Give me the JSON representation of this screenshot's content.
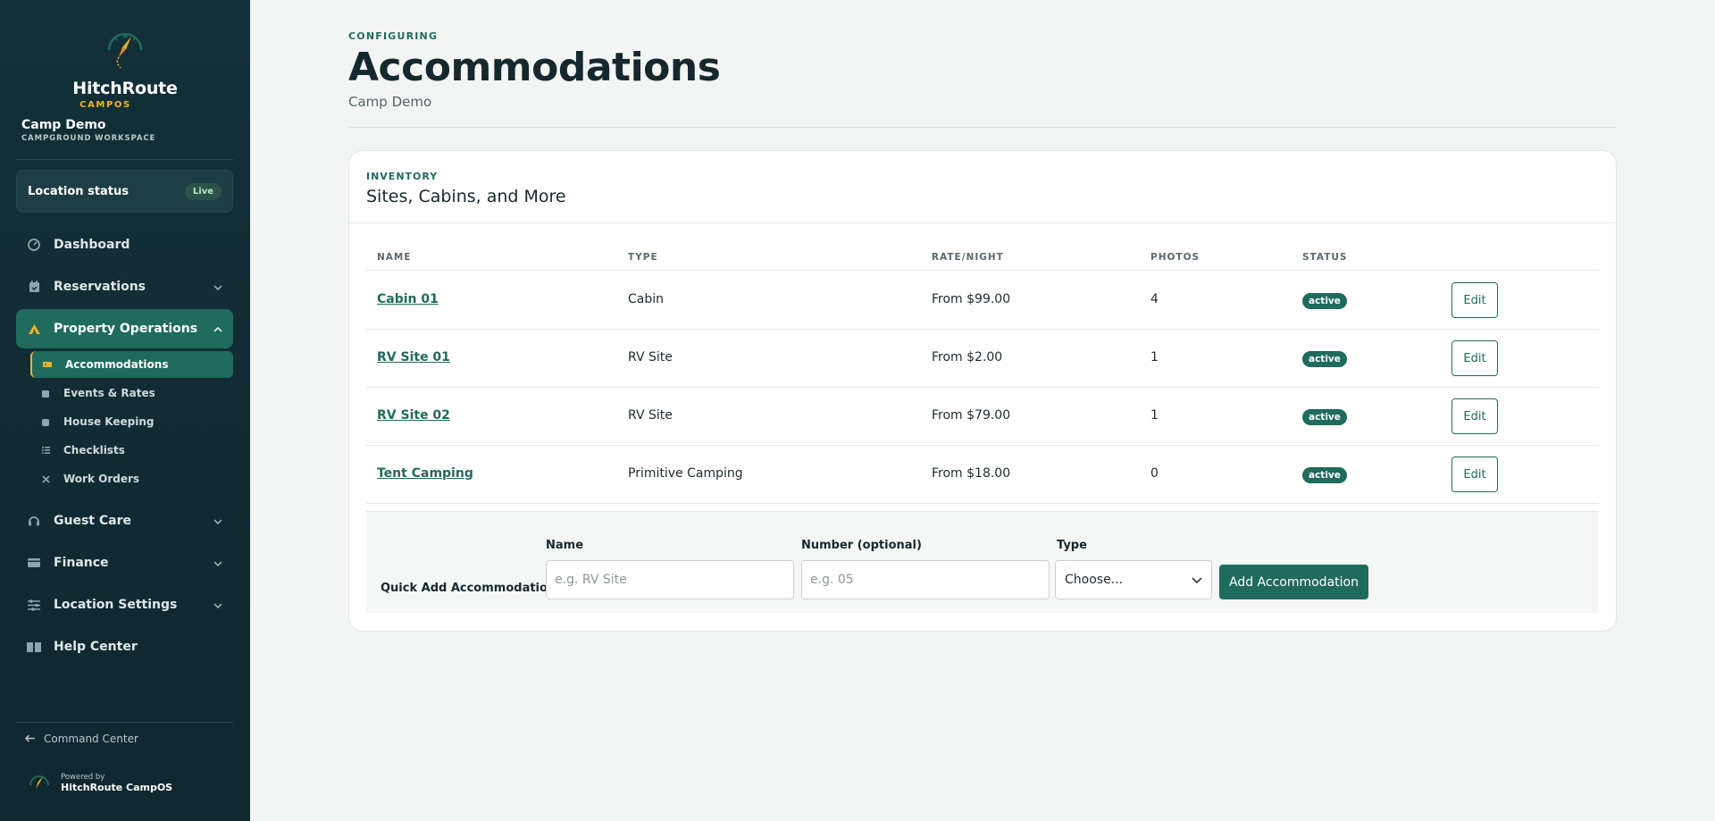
{
  "brand": {
    "name": "HitchRoute",
    "sub": "CAMPOS"
  },
  "workspace": {
    "name": "Camp Demo",
    "sub": "CAMPGROUND WORKSPACE"
  },
  "location_status": {
    "label": "Location status",
    "badge": "Live"
  },
  "nav": {
    "dashboard": "Dashboard",
    "reservations": "Reservations",
    "property_operations": "Property Operations",
    "sub_items": [
      "Accommodations",
      "Events & Rates",
      "House Keeping",
      "Checklists",
      "Work Orders"
    ],
    "guest_care": "Guest Care",
    "finance": "Finance",
    "location_settings": "Location Settings",
    "help_center": "Help Center"
  },
  "footer": {
    "command_center": "Command Center",
    "powered_by": "Powered by",
    "powered_name": "HitchRoute CampOS"
  },
  "page": {
    "eyebrow": "CONFIGURING",
    "title": "Accommodations",
    "subtitle": "Camp Demo"
  },
  "inventory": {
    "eyebrow": "INVENTORY",
    "title": "Sites, Cabins, and More",
    "columns": [
      "NAME",
      "TYPE",
      "RATE/NIGHT",
      "PHOTOS",
      "STATUS"
    ],
    "rows": [
      {
        "name": "Cabin 01",
        "type": "Cabin",
        "rate": "From $99.00",
        "photos": "4",
        "status": "active",
        "action": "Edit"
      },
      {
        "name": "RV Site 01",
        "type": "RV Site",
        "rate": "From $2.00",
        "photos": "1",
        "status": "active",
        "action": "Edit"
      },
      {
        "name": "RV Site 02",
        "type": "RV Site",
        "rate": "From $79.00",
        "photos": "1",
        "status": "active",
        "action": "Edit"
      },
      {
        "name": "Tent Camping",
        "type": "Primitive Camping",
        "rate": "From $18.00",
        "photos": "0",
        "status": "active",
        "action": "Edit"
      }
    ]
  },
  "quick_add": {
    "title": "Quick Add Accommodation",
    "name_label": "Name",
    "name_placeholder": "e.g. RV Site",
    "number_label": "Number (optional)",
    "number_placeholder": "e.g. 05",
    "type_label": "Type",
    "type_value": "Choose...",
    "button": "Add Accommodation"
  },
  "colors": {
    "sidebar": "#133038",
    "accent": "#1f6b5c",
    "gold": "#f0b429",
    "background": "#f3f5f4"
  },
  "icons": [
    "compass-logo-icon",
    "dashboard-icon",
    "calendar-icon",
    "tent-icon",
    "tag-icon",
    "clipboard-icon",
    "list-icon",
    "tools-icon",
    "headset-icon",
    "wallet-icon",
    "sliders-icon",
    "book-icon",
    "arrow-left-icon",
    "chevron-down-icon",
    "chevron-up-icon"
  ]
}
